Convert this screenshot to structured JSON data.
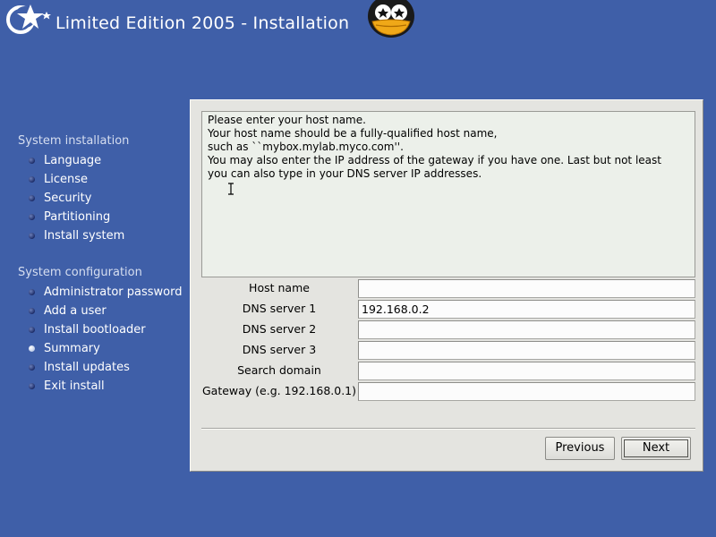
{
  "header": {
    "title": "Limited Edition 2005 - Installation",
    "logo_icon": "star-logo-icon",
    "mascot_icon": "penguin-icon"
  },
  "sidebar": {
    "sections": [
      {
        "title": "System installation",
        "items": [
          {
            "label": "Language"
          },
          {
            "label": "License"
          },
          {
            "label": "Security"
          },
          {
            "label": "Partitioning"
          },
          {
            "label": "Install system"
          }
        ]
      },
      {
        "title": "System configuration",
        "items": [
          {
            "label": "Administrator password"
          },
          {
            "label": "Add a user"
          },
          {
            "label": "Install bootloader"
          },
          {
            "label": "Summary",
            "current": true
          },
          {
            "label": "Install updates"
          },
          {
            "label": "Exit install"
          }
        ]
      }
    ]
  },
  "info": {
    "lines": [
      "Please enter your host name.",
      "Your host name should be a fully-qualified host name,",
      "such as ``mybox.mylab.myco.com''.",
      "You may also enter the IP address of the gateway if you have one. Last but not least",
      "you can also type in your DNS server IP addresses."
    ]
  },
  "form": {
    "fields": [
      {
        "label": "Host name",
        "value": ""
      },
      {
        "label": "DNS server 1",
        "value": "192.168.0.2"
      },
      {
        "label": "DNS server 2",
        "value": ""
      },
      {
        "label": "DNS server 3",
        "value": ""
      },
      {
        "label": "Search domain",
        "value": ""
      },
      {
        "label": "Gateway (e.g. 192.168.0.1)",
        "value": ""
      }
    ]
  },
  "buttons": {
    "previous": "Previous",
    "next": "Next"
  },
  "colors": {
    "background": "#3f5fa8",
    "panel": "#e4e4e0",
    "info_box": "#ecf0ea"
  }
}
